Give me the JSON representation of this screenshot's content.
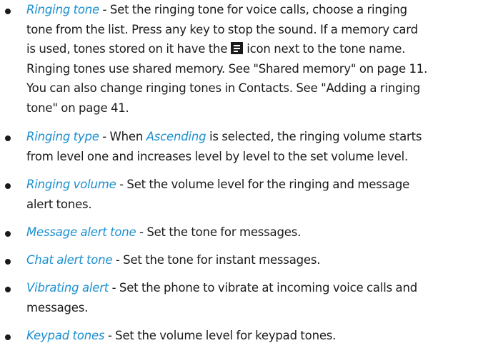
{
  "items": [
    {
      "term": "Ringing tone",
      "line1": " - Set the ringing tone for voice calls, choose a ringing",
      "line2": "tone from the list. Press any key to stop the sound. If a memory card",
      "line3a": "is used, tones stored on it have the",
      "icon": "memory-card-tone-icon",
      "line3b": "icon next to the tone name.",
      "line4": "Ringing tones use shared memory. See \"Shared memory\" on page 11.",
      "line5": "You can also change ringing tones in Contacts. See \"Adding a ringing",
      "line6": "tone\" on page 41."
    },
    {
      "term": "Ringing type",
      "line1a": " - When ",
      "term2": "Ascending",
      "line1b": " is selected, the ringing volume starts",
      "line2": "from level one and increases level by level to the set volume level."
    },
    {
      "term": "Ringing volume",
      "line1": " - Set the volume level for the ringing and message",
      "line2": "alert tones."
    },
    {
      "term": "Message alert tone",
      "line1": " - Set the tone for messages."
    },
    {
      "term": "Chat alert tone",
      "line1": " - Set the tone for instant messages."
    },
    {
      "term": "Vibrating alert",
      "line1": " - Set the phone to vibrate at incoming voice calls and",
      "line2": "messages."
    },
    {
      "term": "Keypad tones",
      "line1": " - Set the volume level for keypad tones."
    }
  ],
  "colors": {
    "term": "#1a8fd0",
    "text": "#1a1a1a"
  }
}
